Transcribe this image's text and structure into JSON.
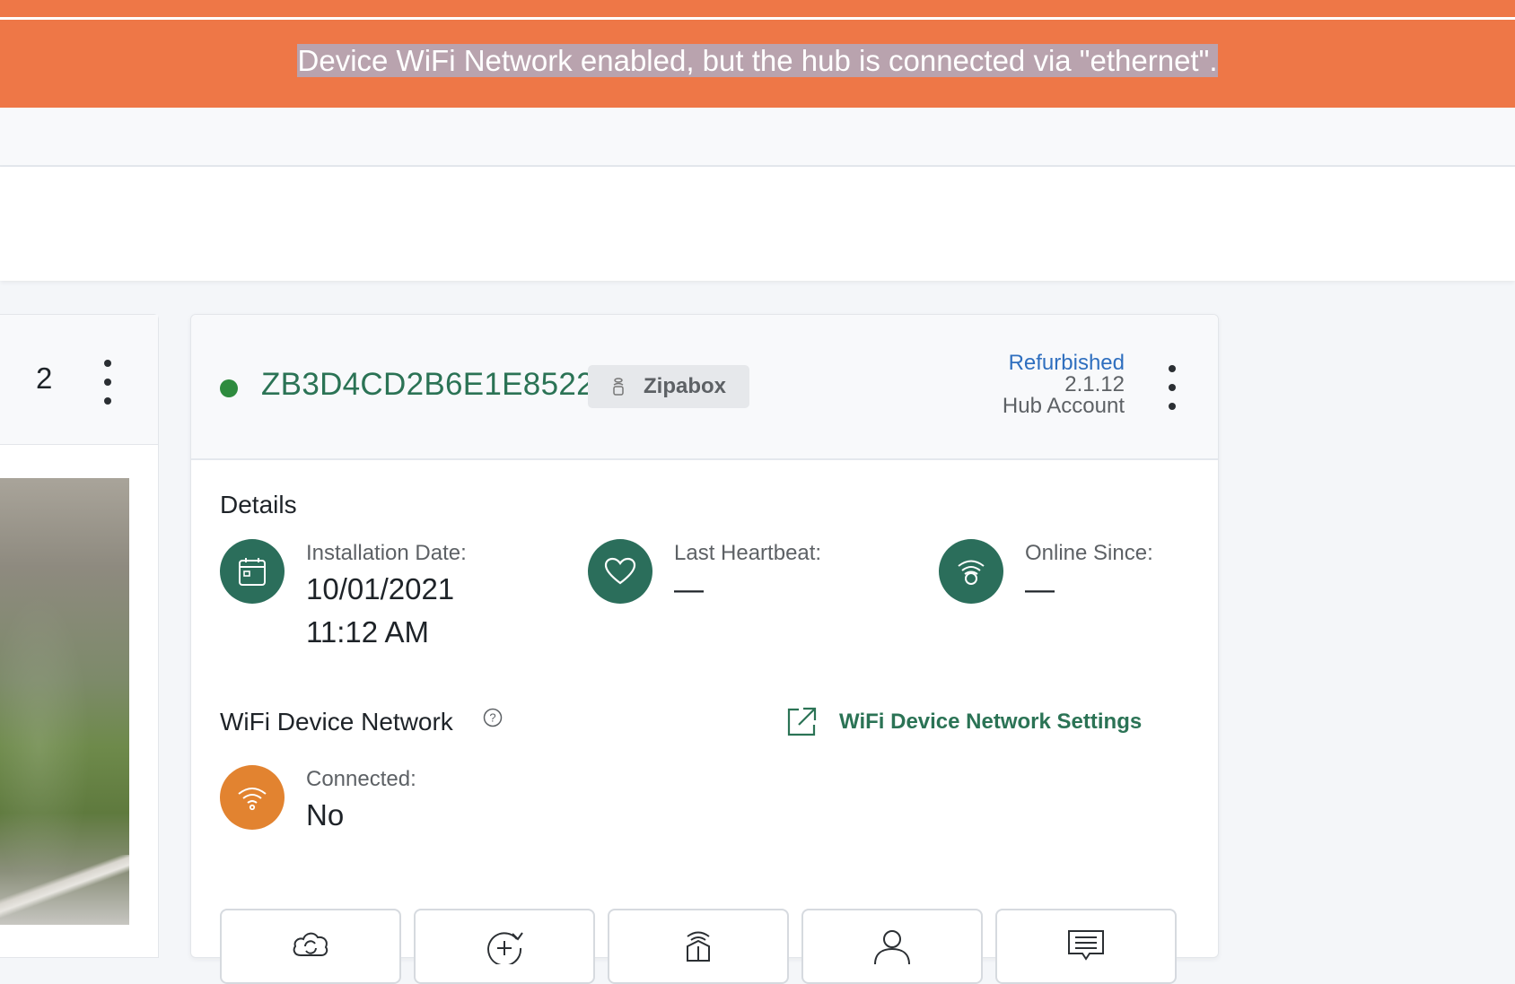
{
  "banner": {
    "message": "Device WiFi Network enabled, but the hub is connected via \"ethernet\"."
  },
  "left_card": {
    "count": "2"
  },
  "hub": {
    "id": "ZB3D4CD2B6E1E8522A",
    "status_color": "#2e8b3e",
    "type_tag": "Zipabox",
    "condition": "Refurbished",
    "firmware": "2.1.12",
    "account": "Hub Account"
  },
  "details": {
    "title": "Details",
    "installation_label": "Installation Date:",
    "installation_date": "10/01/2021",
    "installation_time": "11:12 AM",
    "heartbeat_label": "Last Heartbeat:",
    "heartbeat_value": "—",
    "online_label": "Online Since:",
    "online_value": "—"
  },
  "wifi_network": {
    "title": "WiFi Device Network",
    "settings_link": "WiFi Device Network Settings",
    "connected_label": "Connected:",
    "connected_value": "No"
  },
  "actions": [
    {
      "icon": "cloud-sync-icon"
    },
    {
      "icon": "add-refresh-icon"
    },
    {
      "icon": "hub-device-icon"
    },
    {
      "icon": "user-icon"
    },
    {
      "icon": "message-icon"
    }
  ],
  "colors": {
    "banner": "#ee7747",
    "primary_green": "#2b6e5b",
    "link_green": "#2b7355",
    "warning_orange": "#e28330",
    "link_blue": "#2f6fbf"
  }
}
